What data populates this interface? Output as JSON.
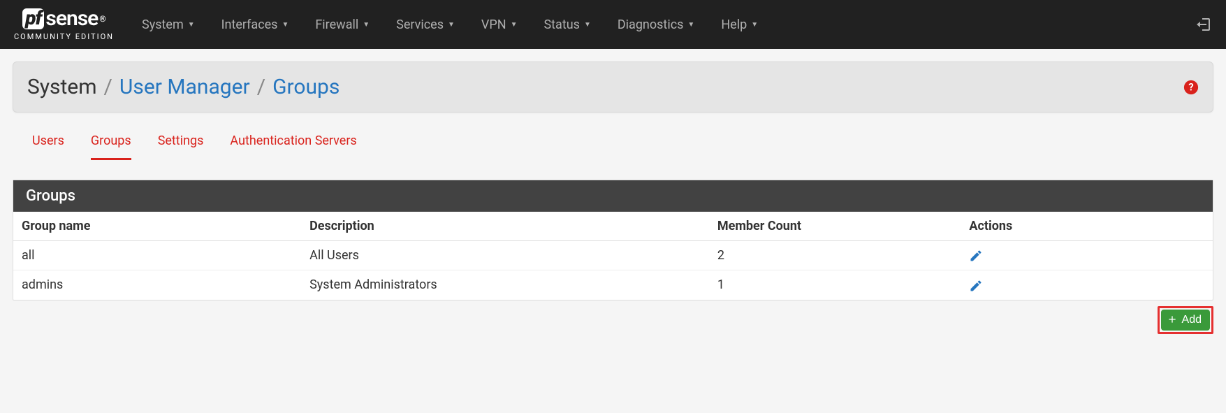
{
  "logo": {
    "brand": "sense",
    "pf": "pf",
    "subtitle": "COMMUNITY EDITION"
  },
  "nav": {
    "items": [
      "System",
      "Interfaces",
      "Firewall",
      "Services",
      "VPN",
      "Status",
      "Diagnostics",
      "Help"
    ]
  },
  "breadcrumb": {
    "root": "System",
    "mid": "User Manager",
    "leaf": "Groups"
  },
  "tabs": [
    {
      "label": "Users",
      "active": false
    },
    {
      "label": "Groups",
      "active": true
    },
    {
      "label": "Settings",
      "active": false
    },
    {
      "label": "Authentication Servers",
      "active": false
    }
  ],
  "panel": {
    "title": "Groups",
    "columns": {
      "name": "Group name",
      "desc": "Description",
      "count": "Member Count",
      "actions": "Actions"
    },
    "rows": [
      {
        "name": "all",
        "desc": "All Users",
        "count": "2"
      },
      {
        "name": "admins",
        "desc": "System Administrators",
        "count": "1"
      }
    ]
  },
  "add_button": {
    "label": "Add"
  }
}
